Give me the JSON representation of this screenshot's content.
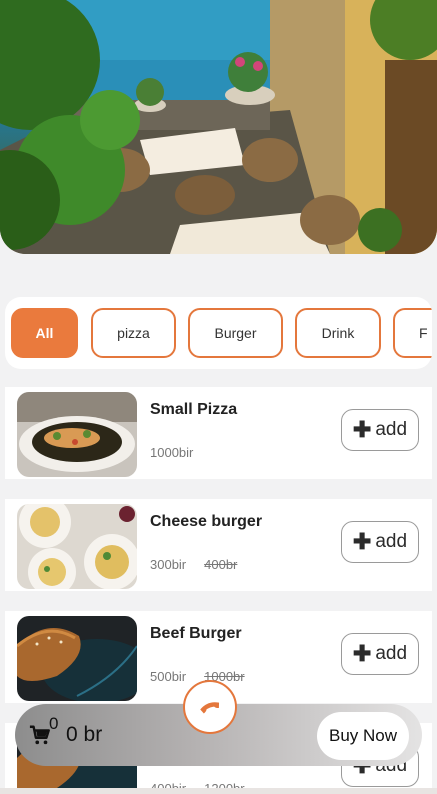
{
  "categories": {
    "items": [
      {
        "label": "All",
        "active": true
      },
      {
        "label": "pizza",
        "active": false
      },
      {
        "label": "Burger",
        "active": false
      },
      {
        "label": "Drink",
        "active": false
      },
      {
        "label": "F",
        "active": false
      }
    ]
  },
  "products": [
    {
      "name": "Small Pizza",
      "price": "1000bir",
      "old_price": "",
      "add_label": "add",
      "image_icon": "pizza-plate"
    },
    {
      "name": "Cheese burger",
      "price": "300bir",
      "old_price": "400br",
      "add_label": "add",
      "image_icon": "pasta-plates"
    },
    {
      "name": "Beef Burger",
      "price": "500bir",
      "old_price": "1000br",
      "add_label": "add",
      "image_icon": "burger-dark"
    },
    {
      "name": "",
      "price": "400bir",
      "old_price": "1200br",
      "add_label": "add",
      "image_icon": "burger-dark"
    }
  ],
  "cart": {
    "count": "0",
    "total": "0 br",
    "buy_label": "Buy Now",
    "icon": "cart-icon"
  },
  "call_button": {
    "icon": "phone-icon"
  },
  "colors": {
    "accent": "#ea7a3d",
    "background": "#f2f2f3",
    "card": "#ffffff"
  }
}
